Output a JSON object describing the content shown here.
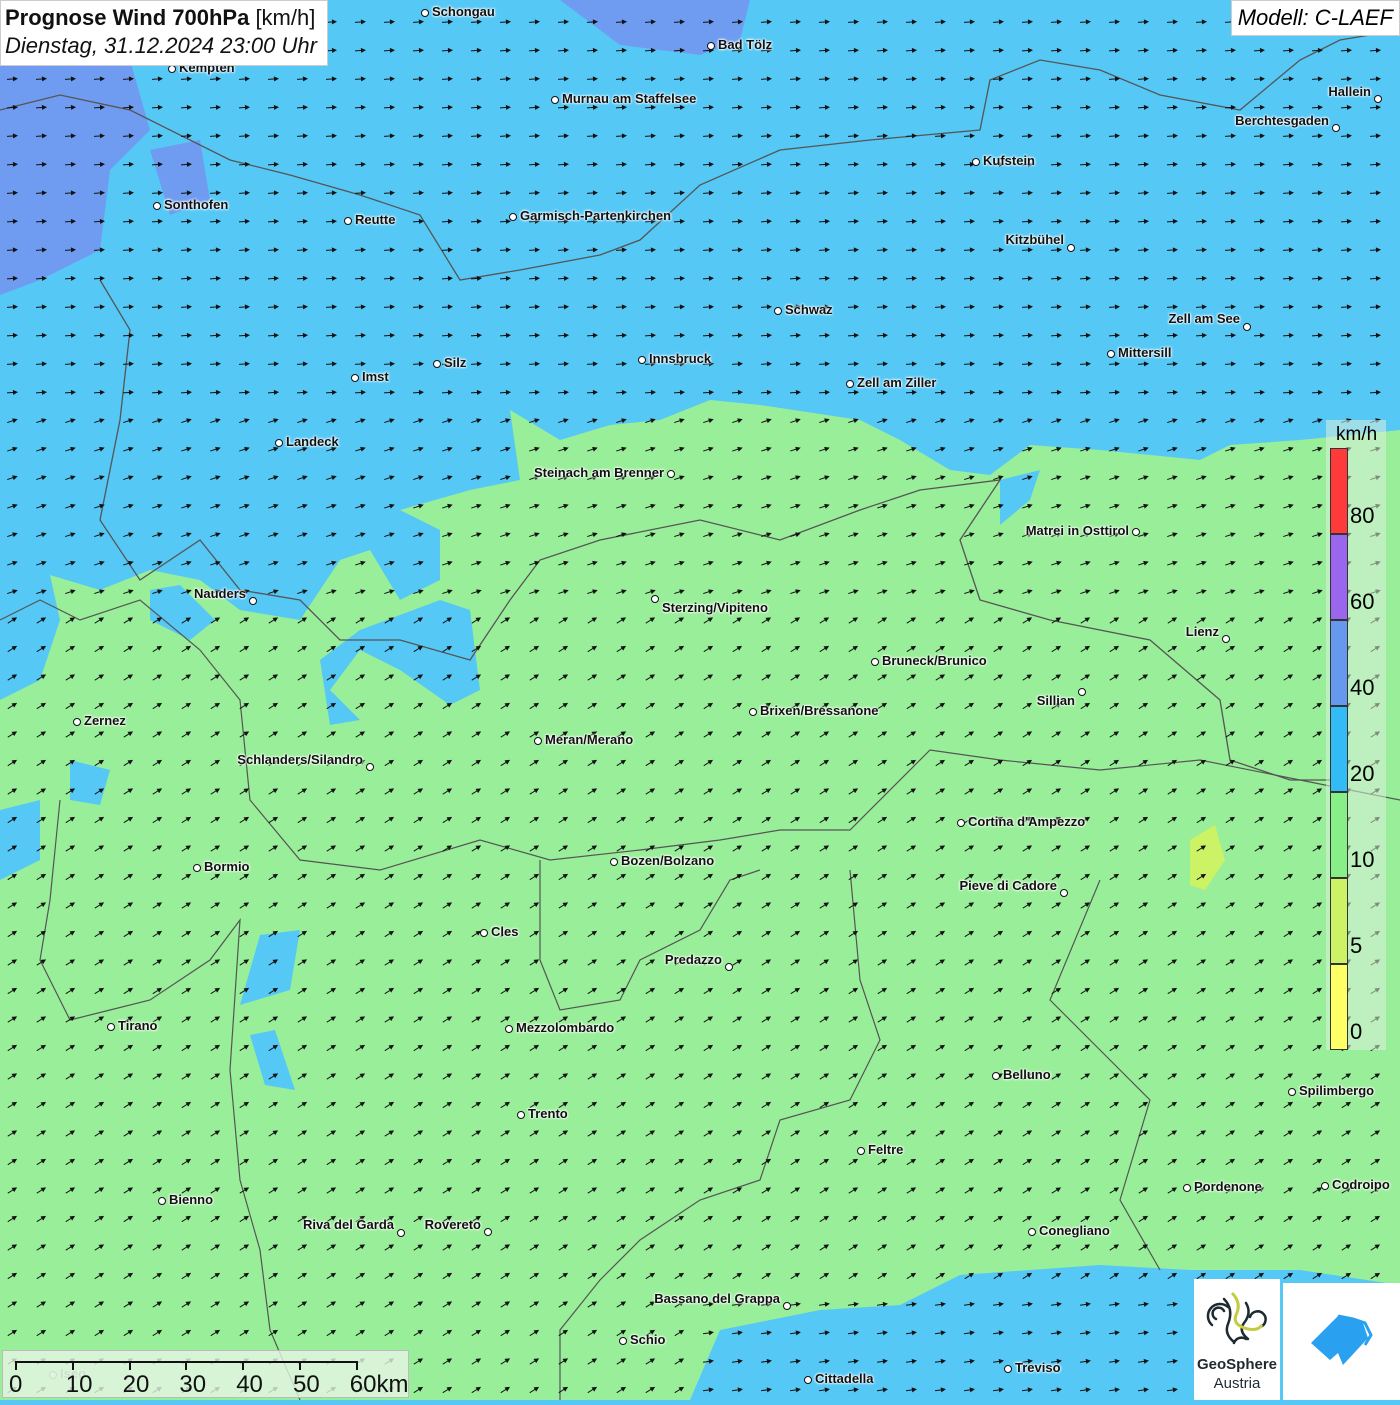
{
  "title": {
    "main": "Prognose Wind 700hPa",
    "unit": "[km/h]",
    "datetime": "Dienstag, 31.12.2024 23:00 Uhr"
  },
  "model": "Modell: C-LAEF",
  "legend": {
    "unit": "km/h",
    "bins": [
      {
        "label": "80",
        "color": "#ff3a3a"
      },
      {
        "label": "60",
        "color": "#9a66ee"
      },
      {
        "label": "40",
        "color": "#6699ee"
      },
      {
        "label": "20",
        "color": "#33bbf5"
      },
      {
        "label": "10",
        "color": "#88ee88"
      },
      {
        "label": "5",
        "color": "#ccf266"
      },
      {
        "label": "0",
        "color": "#ffff66"
      }
    ],
    "top_color": "#ff3a3a"
  },
  "colors": {
    "calm": "#99ee99",
    "moderate": "#55c8f6",
    "strong": "#6f9cf0"
  },
  "scale_bar": {
    "ticks": [
      "0",
      "10",
      "20",
      "30",
      "40",
      "50"
    ],
    "last": "60km"
  },
  "logos": {
    "geosphere_line1": "GeoSphere",
    "geosphere_line2": "Austria"
  },
  "cities": [
    "Schongau",
    "Bad Tölz",
    "Kempten",
    "Murnau am Staffelsee",
    "Hallein",
    "Berchtesgaden",
    "Kufstein",
    "Sonthofen",
    "Reutte",
    "Garmisch-Partenkirchen",
    "Kitzbühel",
    "Schwaz",
    "Zell am See",
    "Mittersill",
    "Innsbruck",
    "Silz",
    "Imst",
    "Zell am Ziller",
    "Landeck",
    "Steinach am Brenner",
    "Matrei in Osttirol",
    "Nauders",
    "Sterzing/Vipiteno",
    "Lienz",
    "Bruneck/Brunico",
    "Sillian",
    "Brixen/Bressanone",
    "Zernez",
    "Meran/Merano",
    "Schlanders/Silandro",
    "Cortina d'Ampezzo",
    "Bozen/Bolzano",
    "Bormio",
    "Pieve di Cadore",
    "Cles",
    "Predazzo",
    "Tirano",
    "Mezzolombardo",
    "Belluno",
    "Spilimbergo",
    "Trento",
    "Feltre",
    "Pordenone",
    "Codroipo",
    "Bienno",
    "Riva del Garda",
    "Rovereto",
    "Conegliano",
    "Bassano del Grappa",
    "Schio",
    "Treviso",
    "Cittadella",
    "Iseo"
  ]
}
